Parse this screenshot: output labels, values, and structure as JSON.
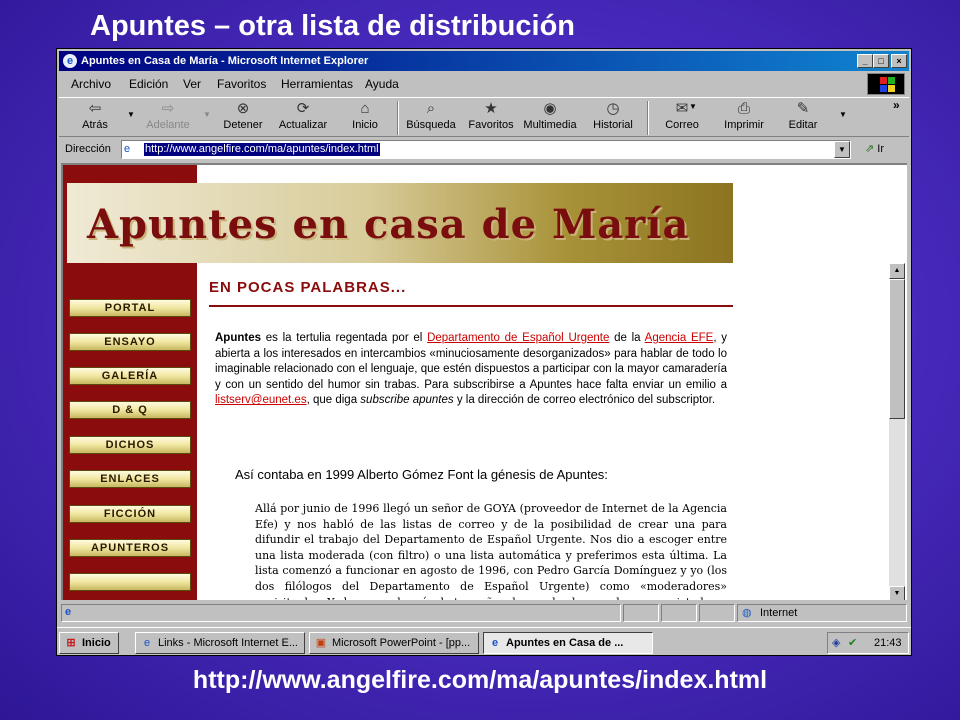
{
  "slide": {
    "title": "Apuntes – otra lista de distribución",
    "footer_url": "http://www.angelfire.com/ma/apuntes/index.html"
  },
  "window": {
    "title": "Apuntes en Casa de María - Microsoft Internet Explorer",
    "controls": {
      "minimize": "_",
      "maximize": "□",
      "close": "×"
    }
  },
  "menu": [
    "Archivo",
    "Edición",
    "Ver",
    "Favoritos",
    "Herramientas",
    "Ayuda"
  ],
  "toolbar": [
    {
      "label": "Atrás",
      "icon": "back-arrow-icon",
      "glyph": "⇦"
    },
    {
      "label": "Adelante",
      "icon": "forward-arrow-icon",
      "glyph": "⇨"
    },
    {
      "label": "Detener",
      "icon": "stop-icon",
      "glyph": "⊗"
    },
    {
      "label": "Actualizar",
      "icon": "refresh-icon",
      "glyph": "⟳"
    },
    {
      "label": "Inicio",
      "icon": "home-icon",
      "glyph": "⌂"
    },
    {
      "label": "Búsqueda",
      "icon": "search-icon",
      "glyph": "⌕"
    },
    {
      "label": "Favoritos",
      "icon": "favorites-icon",
      "glyph": "★"
    },
    {
      "label": "Multimedia",
      "icon": "media-icon",
      "glyph": "◉"
    },
    {
      "label": "Historial",
      "icon": "history-icon",
      "glyph": "◷"
    },
    {
      "label": "Correo",
      "icon": "mail-icon",
      "glyph": "✉"
    },
    {
      "label": "Imprimir",
      "icon": "print-icon",
      "glyph": "⎙"
    },
    {
      "label": "Editar",
      "icon": "edit-icon",
      "glyph": "✎"
    }
  ],
  "toolbar_more": "»",
  "address": {
    "label": "Dirección",
    "value": "http://www.angelfire.com/ma/apuntes/index.html",
    "go_label": "Ir"
  },
  "page": {
    "banner": "Apuntes en casa de María",
    "nav": [
      "PORTAL",
      "ENSAYO",
      "GALERÍA",
      "D & Q",
      "DICHOS",
      "ENLACES",
      "FICCIÓN",
      "APUNTEROS",
      ""
    ],
    "section_title": "EN POCAS PALABRAS...",
    "intro": {
      "bold_start": "Apuntes",
      "text1": " es la tertulia regentada por el ",
      "link1": "Departamento de Español Urgente",
      "text2": " de la ",
      "link2": "Agencia EFE",
      "text3": ", y abierta a los interesados en intercambios «minuciosamente desorganizados» para hablar de todo lo imaginable relacionado con el lenguaje, que estén dispuestos a participar con la mayor camaradería y con un sentido del humor sin trabas. Para subscribirse a Apuntes hace falta enviar un emilio a ",
      "link3": "listserv@eunet.es",
      "text4": ", que diga ",
      "italic": "subscribe apuntes",
      "text5": " y la dirección de correo electrónico del subscriptor."
    },
    "quote_intro": "Así contaba en 1999 Alberto Gómez Font la génesis de Apuntes:",
    "quote": "Allá por junio de 1996 llegó un señor de GOYA (proveedor de Internet de la Agencia Efe) y nos habló de las listas de correo y de la posibilidad de crear una para difundir el trabajo del Departamento de Español Urgente. Nos dio a escoger entre una lista moderada (con filtro) o una lista automática y preferimos esta última. La lista comenzó a funcionar en agosto de 1996, con Pedro García Domínguez y yo (los dos filólogos del Departamento de Español Urgente) como «moderadores» espirituales. Ya han pasado más de tres años, hemos hecho muy buenas amistades"
  },
  "status": {
    "zone": "Internet"
  },
  "taskbar": {
    "start": "Inicio",
    "tasks": [
      {
        "label": "Links - Microsoft Internet E...",
        "active": false
      },
      {
        "label": "Microsoft PowerPoint - [pp...",
        "active": false
      },
      {
        "label": "Apuntes en Casa de ...",
        "active": true
      }
    ],
    "clock": "21:43"
  }
}
